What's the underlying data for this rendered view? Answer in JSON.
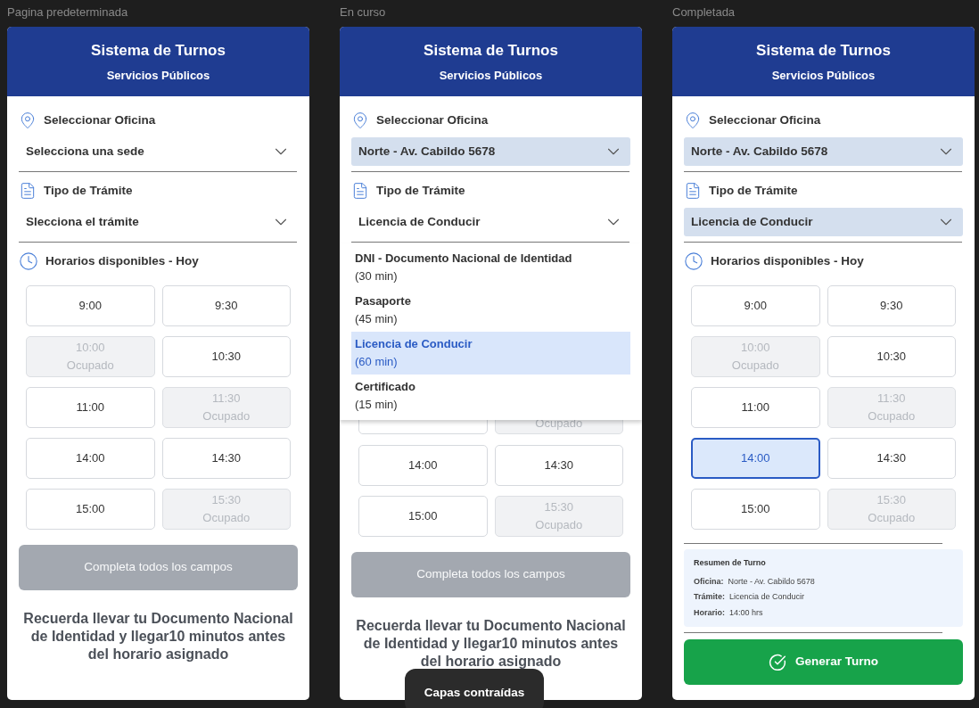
{
  "frames": [
    {
      "caption": "Pagina predeterminada",
      "title": "Sistema de Turnos",
      "subtitle": "Servicios Públicos",
      "office": {
        "label": "Seleccionar Oficina",
        "value": "Selecciona una sede",
        "filled": false
      },
      "procedure": {
        "label": "Tipo de Trámite",
        "value": "Slecciona el trámite",
        "filled": false
      },
      "schedule_label": "Horarios disponibles - Hoy",
      "slot_rows": [
        [
          {
            "time": "9:00",
            "occupied": false,
            "selected": false
          },
          {
            "time": "9:30",
            "occupied": false,
            "selected": false
          }
        ],
        [
          {
            "time": "10:00",
            "note": "Ocupado",
            "occupied": true,
            "selected": false
          },
          {
            "time": "10:30",
            "occupied": false,
            "selected": false
          }
        ],
        [
          {
            "time": "11:00",
            "occupied": false,
            "selected": false
          },
          {
            "time": "11:30",
            "note": "Ocupado",
            "occupied": true,
            "selected": false
          }
        ],
        [
          {
            "time": "14:00",
            "occupied": false,
            "selected": false
          },
          {
            "time": "14:30",
            "occupied": false,
            "selected": false
          }
        ],
        [
          {
            "time": "15:00",
            "occupied": false,
            "selected": false
          },
          {
            "time": "15:30",
            "note": "Ocupado",
            "occupied": true,
            "selected": false
          }
        ]
      ],
      "button": {
        "label": "Completa todos los campos",
        "enabled": false
      },
      "note": "Recuerda llevar tu Documento Nacional de Identidad y llegar10 minutos antes del horario asignado"
    },
    {
      "caption": "En curso",
      "title": "Sistema de Turnos",
      "subtitle": "Servicios Públicos",
      "office": {
        "label": "Seleccionar Oficina",
        "value": "Norte - Av. Cabildo 5678",
        "filled": true
      },
      "procedure": {
        "label": "Tipo de Trámite",
        "value": "Licencia de Conducir",
        "filled": false
      },
      "dropdown": [
        {
          "name": "DNI - Documento Nacional de Identidad",
          "duration": "(30 min)",
          "selected": false
        },
        {
          "name": "Pasaporte",
          "duration": "(45 min)",
          "selected": false
        },
        {
          "name": "Licencia de Conducir",
          "duration": "(60 min)",
          "selected": true
        },
        {
          "name": "Certificado",
          "duration": "(15 min)",
          "selected": false
        }
      ],
      "partial_slots": [
        {
          "occupied": false,
          "selected": false
        },
        {
          "note": "Ocupado",
          "occupied": true,
          "selected": false
        }
      ],
      "slot_rows": [
        [
          {
            "time": "14:00",
            "occupied": false,
            "selected": false
          },
          {
            "time": "14:30",
            "occupied": false,
            "selected": false
          }
        ],
        [
          {
            "time": "15:00",
            "occupied": false,
            "selected": false
          },
          {
            "time": "15:30",
            "note": "Ocupado",
            "occupied": true,
            "selected": false
          }
        ]
      ],
      "button": {
        "label": "Completa todos los campos",
        "enabled": false
      },
      "note": "Recuerda llevar tu Documento Nacional de Identidad y llegar10 minutos antes del horario asignado"
    },
    {
      "caption": "Completada",
      "title": "Sistema de Turnos",
      "subtitle": "Servicios Públicos",
      "office": {
        "label": "Seleccionar Oficina",
        "value": "Norte - Av. Cabildo 5678",
        "filled": true
      },
      "procedure": {
        "label": "Tipo de Trámite",
        "value": "Licencia de Conducir",
        "filled": true
      },
      "schedule_label": "Horarios disponibles - Hoy",
      "slot_rows": [
        [
          {
            "time": "9:00",
            "occupied": false,
            "selected": false
          },
          {
            "time": "9:30",
            "occupied": false,
            "selected": false
          }
        ],
        [
          {
            "time": "10:00",
            "note": "Ocupado",
            "occupied": true,
            "selected": false
          },
          {
            "time": "10:30",
            "occupied": false,
            "selected": false
          }
        ],
        [
          {
            "time": "11:00",
            "occupied": false,
            "selected": false
          },
          {
            "time": "11:30",
            "note": "Ocupado",
            "occupied": true,
            "selected": false
          }
        ],
        [
          {
            "time": "14:00",
            "occupied": false,
            "selected": true
          },
          {
            "time": "14:30",
            "occupied": false,
            "selected": false
          }
        ],
        [
          {
            "time": "15:00",
            "occupied": false,
            "selected": false
          },
          {
            "time": "15:30",
            "note": "Ocupado",
            "occupied": true,
            "selected": false
          }
        ]
      ],
      "summary": {
        "title": "Resumen de Turno",
        "rows": [
          {
            "label": "Oficina:",
            "value": "Norte - Av. Cabildo 5678"
          },
          {
            "label": "Trámite:",
            "value": "Licencia de Conducir"
          },
          {
            "label": "Horario:",
            "value": "14:00 hrs"
          }
        ]
      },
      "button": {
        "label": "Generar Turno",
        "enabled": true
      }
    }
  ],
  "toast": "Capas contraídas"
}
